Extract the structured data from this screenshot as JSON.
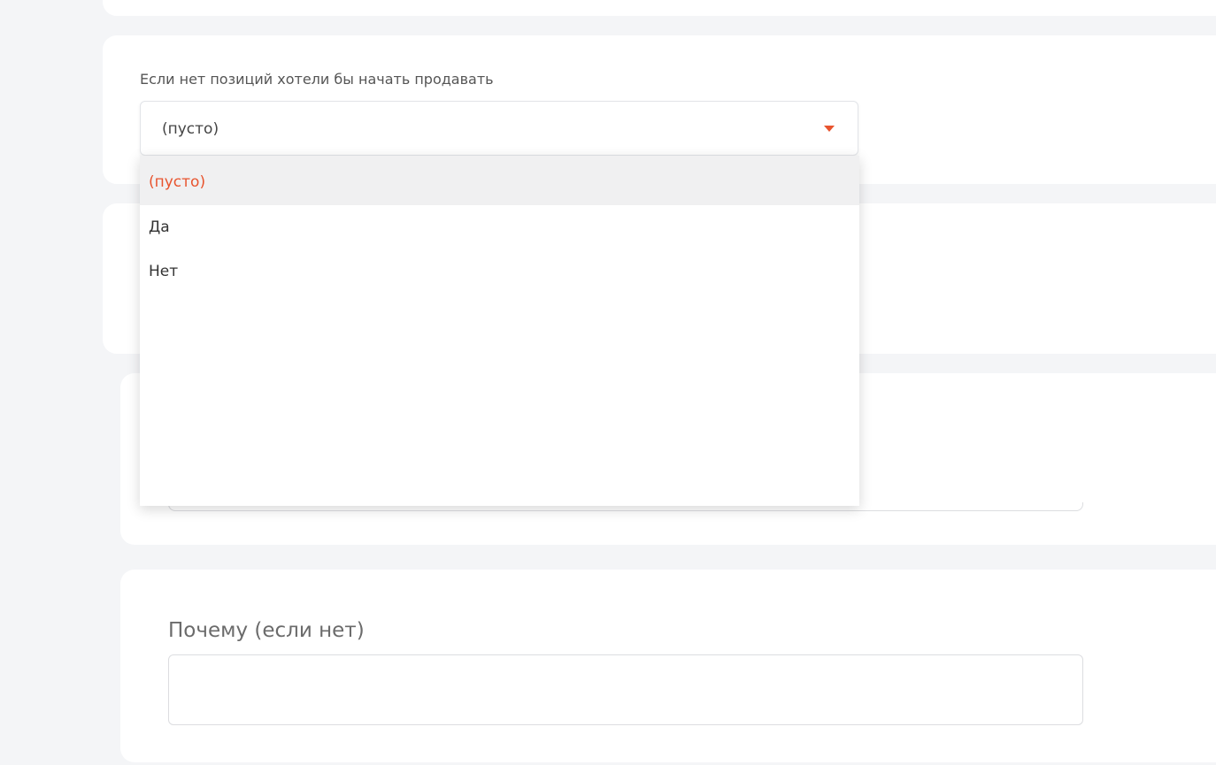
{
  "form": {
    "sell_question": {
      "label": "Если нет позиций хотели бы начать продавать",
      "selected_value": "(пусто)",
      "options": [
        "(пусто)",
        "Да",
        "Нет"
      ],
      "accent_color": "#e8542e"
    },
    "why_question": {
      "label": "Почему (если нет)",
      "value": ""
    }
  }
}
